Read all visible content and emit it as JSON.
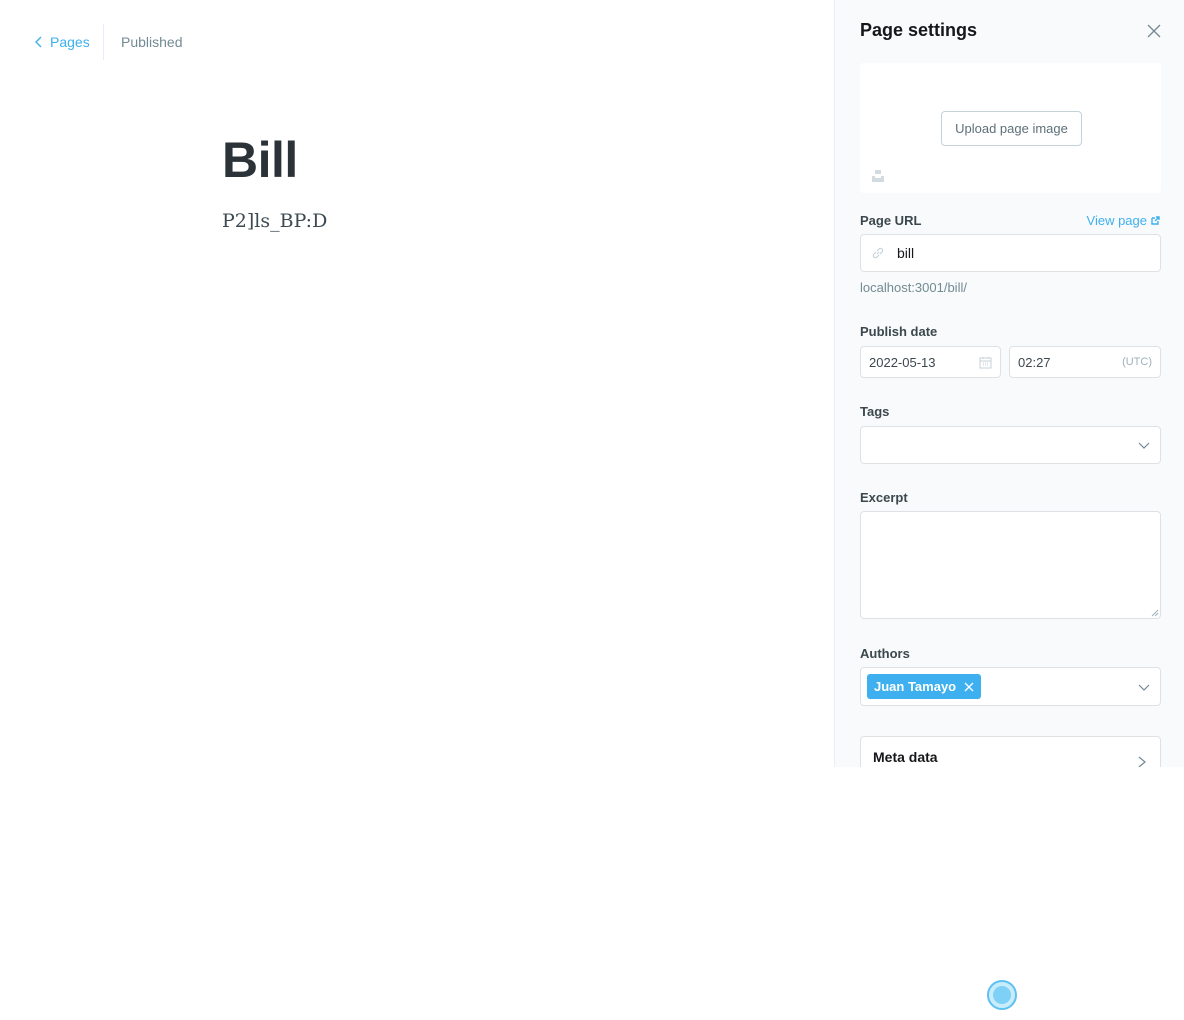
{
  "header": {
    "back_label": "Pages",
    "status": "Published"
  },
  "editor": {
    "title": "Bill",
    "body": "P2]ls_BP:D"
  },
  "settings": {
    "title": "Page settings",
    "upload_label": "Upload page image",
    "page_url_label": "Page URL",
    "view_page_label": "View page",
    "slug": "bill",
    "url_hint": "localhost:3001/bill/",
    "publish_date_label": "Publish date",
    "date": "2022-05-13",
    "time": "02:27",
    "timezone": "(UTC)",
    "tags_label": "Tags",
    "excerpt_label": "Excerpt",
    "authors_label": "Authors",
    "authors": [
      "Juan Tamayo"
    ],
    "meta_label": "Meta data"
  },
  "colors": {
    "accent": "#3eb0ef",
    "panel_bg": "#f8fafb"
  },
  "icons": [
    "chevron-left-icon",
    "close-icon",
    "unsplash-icon",
    "external-link-icon",
    "link-icon",
    "calendar-icon",
    "chevron-down-icon",
    "chevron-right-icon"
  ]
}
